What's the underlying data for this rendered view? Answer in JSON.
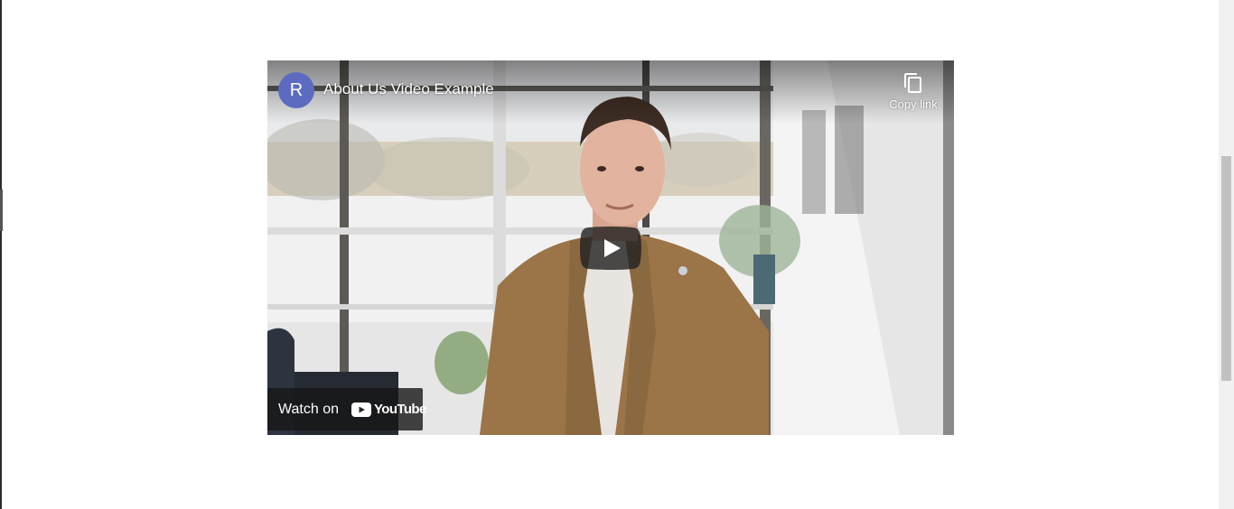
{
  "video": {
    "channel_initial": "R",
    "title": "About Us Video Example",
    "copy_link_label": "Copy link",
    "watch_on_label": "Watch on",
    "youtube_wordmark": "YouTube",
    "avatar_color": "#5c6bc0",
    "play_button_color": "#212121"
  },
  "icons": {
    "copy": "copy-icon",
    "play": "play-icon",
    "youtube": "youtube-logo-icon"
  }
}
